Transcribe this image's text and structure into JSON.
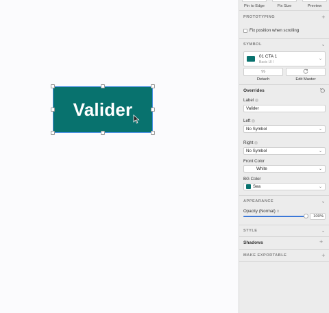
{
  "canvas": {
    "button_label": "Valider",
    "button_color": "#08726e",
    "selection_color": "#4a90e2"
  },
  "inspector": {
    "top_tabs": [
      "Pin to Edge",
      "Fix Size",
      "Preview"
    ],
    "prototyping": {
      "header": "PROTOTYPING",
      "fix_position_label": "Fix position when scrolling",
      "fix_position_checked": false
    },
    "symbol": {
      "header": "SYMBOL",
      "name": "01 CTA 1",
      "path": "Basic UI /",
      "thumb_label": "Label",
      "detach_label": "Detach",
      "edit_master_label": "Edit Master"
    },
    "overrides": {
      "header": "Overrides",
      "label_title": "Label",
      "label_value": "Valider",
      "left_title": "Left",
      "left_value": "No Symbol",
      "right_title": "Right",
      "right_value": "No Symbol",
      "front_color_title": "Front Color",
      "front_color_value": "White",
      "bg_color_title": "BG Color",
      "bg_color_value": "Sea",
      "bg_color_hex": "#08726e"
    },
    "appearance": {
      "header": "APPEARANCE",
      "opacity_label": "Opacity (Normal)",
      "opacity_value": "100%",
      "opacity_fraction": 1.0
    },
    "style_header": "STYLE",
    "shadows_header": "Shadows",
    "export_header": "MAKE EXPORTABLE"
  }
}
